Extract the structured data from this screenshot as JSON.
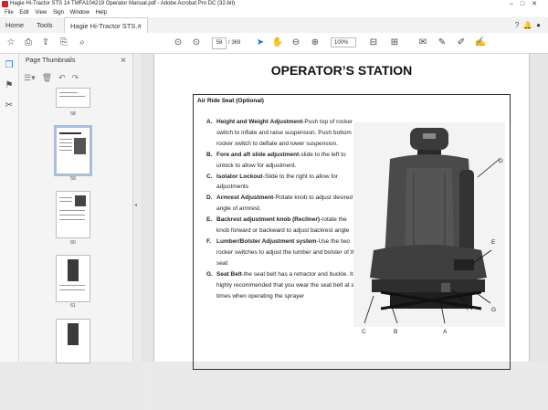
{
  "window": {
    "title": "Hagie Hi-Tractor STS 14 TMFA104219 Operator Manual.pdf - Adobe Acrobat Pro DC (32-bit)"
  },
  "menu": [
    "File",
    "Edit",
    "View",
    "Sign",
    "Window",
    "Help"
  ],
  "tabs": {
    "home": "Home",
    "tools": "Tools",
    "document": "Hagie Hi-Tractor STS..."
  },
  "toolbar": {
    "page_current": "58",
    "page_total": "/ 369",
    "zoom": "100%"
  },
  "thumbnails": {
    "title": "Page Thumbnails",
    "pages": [
      "58",
      "59",
      "60",
      "61"
    ]
  },
  "page": {
    "heading": "OPERATOR’S STATION",
    "section_title": "Air Ride Seat (Optional)",
    "items": [
      {
        "letter": "A.",
        "head": "Height and Weight Adjustment",
        "body": "-Push top of rocker switch to inflate and raise suspension. Push bottom of rocker switch to deflate and lower suspension."
      },
      {
        "letter": "B.",
        "head": "Fore and aft slide adjustment",
        "body": "-slide to the left to unlock to allow for adjustment."
      },
      {
        "letter": "C.",
        "head": "Isolator Lockout",
        "body": "-Slide to the right to allow for adjustments"
      },
      {
        "letter": "D.",
        "head": "Armrest Adjustment",
        "body": "-Rotate knob to adjust desired angle of armrest."
      },
      {
        "letter": "E.",
        "head": "Backrest adjustment knob (Recliner)",
        "body": "-rotate the knob forward or backward to adjust backrest angle"
      },
      {
        "letter": "F.",
        "head": "Lumber/Bolster Adjustment system",
        "body": "-Use the two rocker switches to adjust the lumber and bolster of the seat"
      },
      {
        "letter": "G.",
        "head": "Seat Belt",
        "body": "-the seat belt has a retractor and buckle. It is highly recommended that you wear the seat belt at all times when operating the sprayer"
      }
    ],
    "callouts": {
      "a": "A",
      "b": "B",
      "c": "C",
      "d": "D",
      "e": "E",
      "f": "F",
      "g": "G"
    }
  },
  "colors": {
    "accent": "#1473e6",
    "acrobat_red": "#d4202a"
  }
}
